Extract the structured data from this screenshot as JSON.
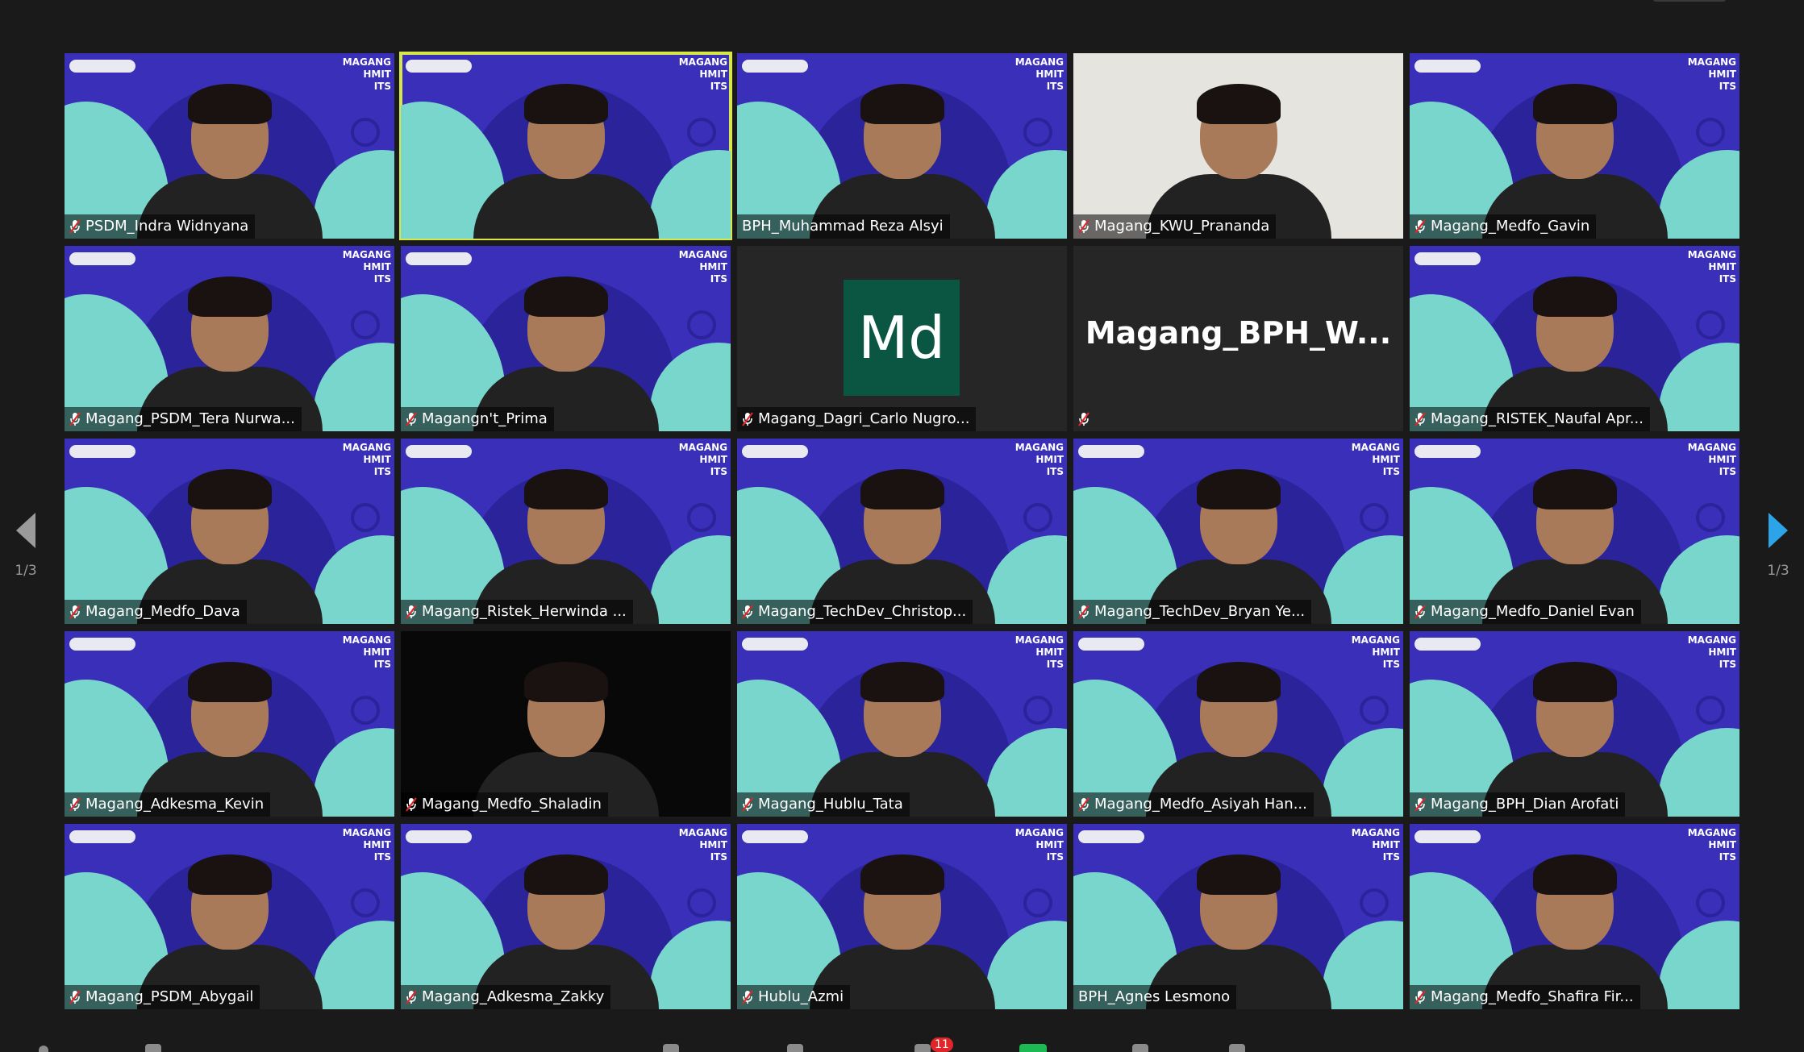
{
  "window": {
    "page_indicator": "1/3"
  },
  "brand": {
    "tag_lines": [
      "MAGANG",
      "HMIT",
      "ITS"
    ]
  },
  "participants": [
    {
      "name": "PSDM_Indra Widnyana",
      "muted": true,
      "bg": "brand",
      "active": false
    },
    {
      "name": "",
      "muted": false,
      "bg": "brand",
      "active": true
    },
    {
      "name": "BPH_Muhammad Reza Alsyi",
      "muted": false,
      "bg": "brand",
      "active": false
    },
    {
      "name": "Magang_KWU_Prananda",
      "muted": true,
      "bg": "white",
      "active": false
    },
    {
      "name": "Magang_Medfo_Gavin",
      "muted": true,
      "bg": "brand",
      "active": false
    },
    {
      "name": "Magang_PSDM_Tera Nurwa...",
      "muted": true,
      "bg": "brand",
      "active": false
    },
    {
      "name": "Magangn't_Prima",
      "muted": true,
      "bg": "brand",
      "active": false
    },
    {
      "name": "Magang_Dagri_Carlo Nugro...",
      "muted": true,
      "bg": "dark",
      "active": false,
      "avatar": "Md"
    },
    {
      "name": "",
      "muted": true,
      "bg": "dark",
      "active": false,
      "big_name": "Magang_BPH_W..."
    },
    {
      "name": "Magang_RISTEK_Naufal Apr...",
      "muted": true,
      "bg": "brand",
      "active": false
    },
    {
      "name": "Magang_Medfo_Dava",
      "muted": true,
      "bg": "brand",
      "active": false
    },
    {
      "name": "Magang_Ristek_Herwinda ...",
      "muted": true,
      "bg": "brand",
      "active": false
    },
    {
      "name": "Magang_TechDev_Christop...",
      "muted": true,
      "bg": "brand",
      "active": false
    },
    {
      "name": "Magang_TechDev_Bryan Ye...",
      "muted": true,
      "bg": "brand",
      "active": false
    },
    {
      "name": "Magang_Medfo_Daniel Evan",
      "muted": true,
      "bg": "brand",
      "active": false
    },
    {
      "name": "Magang_Adkesma_Kevin",
      "muted": true,
      "bg": "brand",
      "active": false
    },
    {
      "name": "Magang_Medfo_Shaladin",
      "muted": true,
      "bg": "black",
      "active": false
    },
    {
      "name": "Magang_Hublu_Tata",
      "muted": true,
      "bg": "brand",
      "active": false
    },
    {
      "name": "Magang_Medfo_Asiyah Han...",
      "muted": true,
      "bg": "brand",
      "active": false
    },
    {
      "name": "Magang_BPH_Dian Arofati",
      "muted": true,
      "bg": "brand",
      "active": false
    },
    {
      "name": "Magang_PSDM_Abygail",
      "muted": true,
      "bg": "brand",
      "active": false
    },
    {
      "name": "Magang_Adkesma_Zakky",
      "muted": true,
      "bg": "brand",
      "active": false
    },
    {
      "name": "Hublu_Azmi",
      "muted": true,
      "bg": "brand",
      "active": false
    },
    {
      "name": "BPH_Agnes Lesmono",
      "muted": false,
      "bg": "brand",
      "active": false
    },
    {
      "name": "Magang_Medfo_Shafira Fir...",
      "muted": true,
      "bg": "brand",
      "active": false
    }
  ],
  "toolbar": {
    "chat_badge": "11"
  },
  "colors": {
    "brand_bg": "#3a2fb8",
    "accent_teal": "#79d6cc",
    "active_speaker": "#d6e74a",
    "mute_red": "#e0262a",
    "nav_next": "#2da4e8"
  }
}
